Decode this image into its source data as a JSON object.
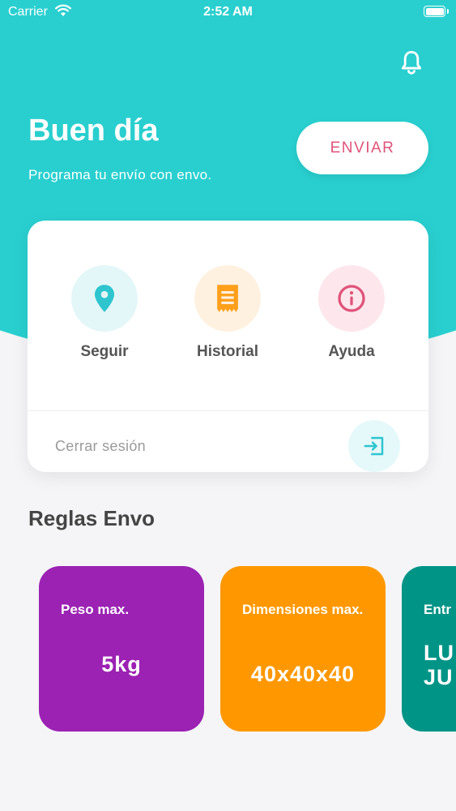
{
  "status_bar": {
    "carrier": "Carrier",
    "time": "2:52 AM"
  },
  "header": {
    "greeting": "Buen día",
    "subtitle": "Programa tu envío con envo.",
    "send_button": "ENVIAR"
  },
  "menu": {
    "items": [
      {
        "label": "Seguir",
        "icon": "location-pin-icon"
      },
      {
        "label": "Historial",
        "icon": "receipt-icon"
      },
      {
        "label": "Ayuda",
        "icon": "info-icon"
      }
    ],
    "logout_label": "Cerrar sesión"
  },
  "rules": {
    "title": "Reglas Envo",
    "cards": [
      {
        "title": "Peso max.",
        "value": "5kg",
        "color": "#9b22b3"
      },
      {
        "title": "Dimensiones max.",
        "value": "40x40x40",
        "color": "#ff9800"
      },
      {
        "title": "Entr",
        "value": "LU\nJU",
        "color": "#009486"
      }
    ]
  },
  "colors": {
    "header": "#29cfcf",
    "accent_pink": "#e0537a",
    "icon_teal": "#2ec5cf",
    "icon_orange": "#ff9f1a",
    "icon_pink": "#e0537a"
  }
}
